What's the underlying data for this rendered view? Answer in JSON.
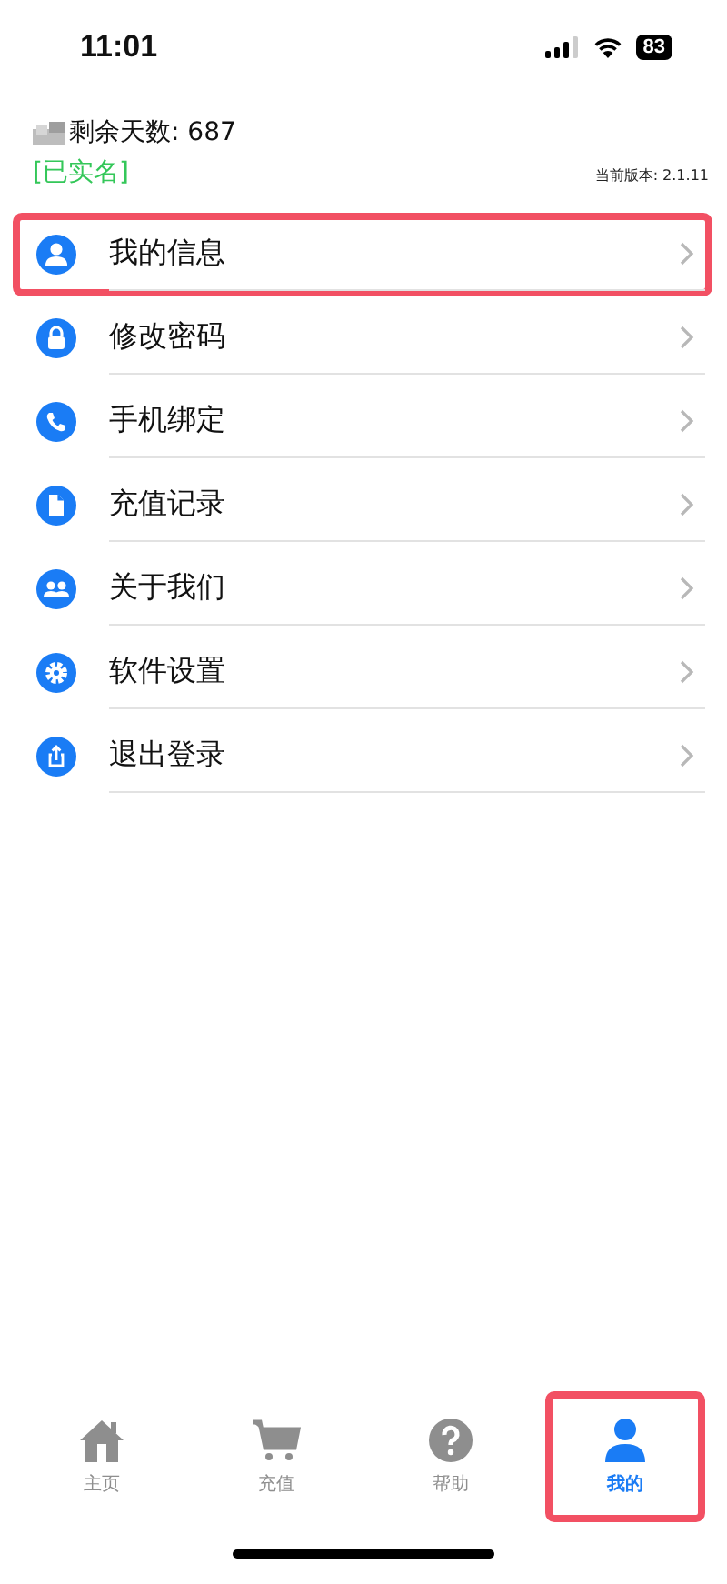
{
  "status_bar": {
    "time": "11:01",
    "battery": "83"
  },
  "header": {
    "days_label": "剩余天数: 687",
    "verified": "[已实名]",
    "version": "当前版本: 2.1.11"
  },
  "menu": [
    {
      "label": "我的信息",
      "kind": "person",
      "highlighted": true
    },
    {
      "label": "修改密码",
      "kind": "lock",
      "highlighted": false
    },
    {
      "label": "手机绑定",
      "kind": "phone",
      "highlighted": false
    },
    {
      "label": "充值记录",
      "kind": "file",
      "highlighted": false
    },
    {
      "label": "关于我们",
      "kind": "group",
      "highlighted": false
    },
    {
      "label": "软件设置",
      "kind": "gear",
      "highlighted": false
    },
    {
      "label": "退出登录",
      "kind": "share",
      "highlighted": false
    }
  ],
  "tabs": [
    {
      "label": "主页",
      "kind": "home",
      "selected": false,
      "highlighted": false
    },
    {
      "label": "充值",
      "kind": "cart",
      "selected": false,
      "highlighted": false
    },
    {
      "label": "帮助",
      "kind": "help",
      "selected": false,
      "highlighted": false
    },
    {
      "label": "我的",
      "kind": "person",
      "selected": true,
      "highlighted": true
    }
  ]
}
